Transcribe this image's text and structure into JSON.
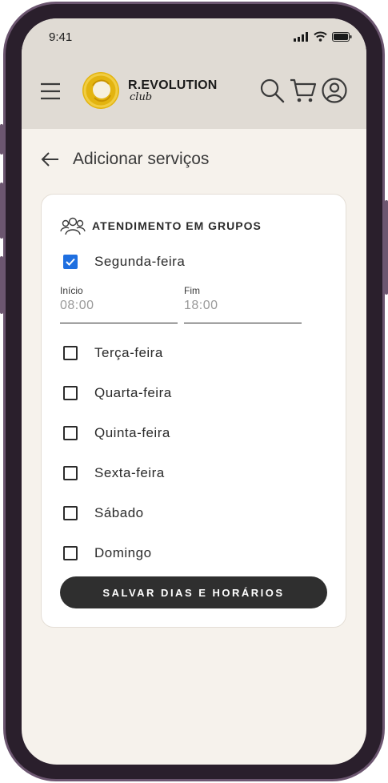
{
  "status_bar": {
    "time": "9:41"
  },
  "header": {
    "logo_name": "R.EVOLUTION",
    "logo_sub": "club"
  },
  "page": {
    "title": "Adicionar serviços"
  },
  "card": {
    "section_title": "ATENDIMENTO EM GRUPOS",
    "days": [
      {
        "label": "Segunda-feira",
        "checked": true
      },
      {
        "label": "Terça-feira",
        "checked": false
      },
      {
        "label": "Quarta-feira",
        "checked": false
      },
      {
        "label": "Quinta-feira",
        "checked": false
      },
      {
        "label": "Sexta-feira",
        "checked": false
      },
      {
        "label": "Sábado",
        "checked": false
      },
      {
        "label": "Domingo",
        "checked": false
      }
    ],
    "start": {
      "label": "Início",
      "placeholder": "08:00"
    },
    "end": {
      "label": "Fim",
      "placeholder": "18:00"
    },
    "save_label": "SALVAR DIAS E HORÁRIOS"
  },
  "colors": {
    "header_bg": "#e0dbd4",
    "page_bg": "#f6f2ec",
    "checkbox_checked": "#1f6fe0",
    "button_bg": "#2f2f2f",
    "frame": "#6c5670"
  }
}
